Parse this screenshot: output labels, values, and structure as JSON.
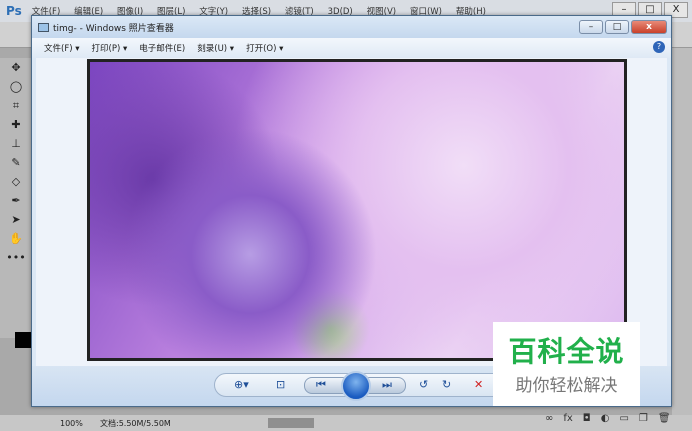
{
  "photoshop": {
    "logo": "Ps",
    "menu": [
      "文件(F)",
      "编辑(E)",
      "图像(I)",
      "图层(L)",
      "文字(Y)",
      "选择(S)",
      "滤镜(T)",
      "3D(D)",
      "视图(V)",
      "窗口(W)",
      "帮助(H)"
    ],
    "window_controls": [
      "–",
      "□",
      "X"
    ],
    "tools": [
      "move",
      "lasso",
      "crop",
      "healing",
      "stamp",
      "eraser",
      "blur",
      "pen",
      "select",
      "hand",
      "more"
    ],
    "status": {
      "zoom": "100%",
      "doc": "文档:5.50M/5.50M"
    },
    "layer_icons": [
      "link",
      "fx",
      "mask",
      "adjust",
      "folder",
      "new",
      "trash"
    ]
  },
  "viewer": {
    "title": "timg- - Windows 照片查看器",
    "menu": [
      "文件(F) ▾",
      "打印(P) ▾",
      "电子邮件(E)",
      "刻录(U) ▾",
      "打开(O) ▾"
    ],
    "help": "?",
    "toolbar": [
      "zoom",
      "fit",
      "previous",
      "slideshow",
      "next",
      "rotate-left",
      "rotate-right",
      "delete"
    ]
  },
  "watermark": {
    "main": "百科全说",
    "sub": "助你轻松解决"
  }
}
